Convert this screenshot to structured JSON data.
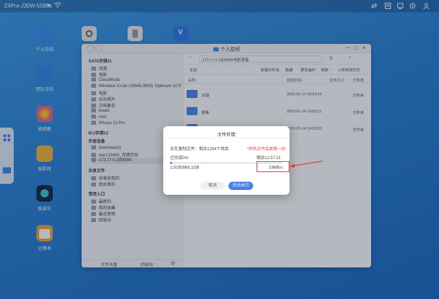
{
  "topbar": {
    "device_name": "Z4Pro-J30W-5588a",
    "caret": "▾"
  },
  "desktop": {
    "icons": [
      {
        "label": "个人空间",
        "color": "#3f8ef0"
      },
      {
        "label": "团队空间",
        "color": "#3a86e8"
      },
      {
        "label": "极相册",
        "color": "#f2a43a"
      },
      {
        "label": "极影视",
        "color": "#f4b63a"
      },
      {
        "label": "极音乐",
        "color": "#3ad0c8"
      },
      {
        "label": "记事本",
        "color": "#f7a23c"
      }
    ]
  },
  "window": {
    "title": "个人空间",
    "path": "172.17.0.2@8080/电影演唱",
    "toolbar": [
      "全选",
      "新建文件夹",
      "新建",
      "更多操作",
      "刷新",
      "上传电视文件"
    ],
    "columns": {
      "name": "名称",
      "modified": "修改时间",
      "size": "文件大小",
      "type": "文件类"
    },
    "files": [
      {
        "name": "动漫",
        "modified": "2023-01-14 19:54:15",
        "type": "文件夹"
      },
      {
        "name": "剧集",
        "modified": "2023-01-14 19:53:11",
        "type": "文件夹"
      },
      {
        "name": "",
        "modified": "2023-01-14 19:53:53",
        "type": "文件夹"
      }
    ],
    "sidebar": {
      "sections": [
        {
          "head": "SATA存储11",
          "items": [
            "动漫",
            "电影",
            "CloudMusic",
            "Windows X-Lite (19045.3930) 'Optimum 10 P",
            "电影",
            "乐乐照片",
            "文档备份",
            "books",
            "mov",
            "iPhone 13 Pro"
          ]
        },
        {
          "head": "M.2存储12",
          "items": []
        },
        {
          "head": "外部设备",
          "items": [
            "downloads3",
            "star123456_存储空间",
            "172.17.0.2@8080"
          ]
        },
        {
          "head": "共享文件",
          "items": [
            "共享给我的",
            "我共享的"
          ]
        },
        {
          "head": "常用入口",
          "items": [
            "最新的",
            "我的收藏",
            "最近使用",
            "回收站"
          ]
        }
      ],
      "footer_left": "文件去重",
      "footer_right": "回收站"
    }
  },
  "dialog": {
    "title": "文件处理",
    "copying_label": "正在复制文件：剩余1294个项目",
    "duplicate_notice": "*同名文件会复制一份",
    "completed_label": "已完成0%",
    "remaining_label": "剩余12:57:21",
    "size_progress": "1.5GB/868.1GB",
    "speed": "19MB/s",
    "progress_fraction": 0.002,
    "cancel_label": "取消",
    "background_label": "后台执行"
  },
  "colors": {
    "accent": "#4a7fe8",
    "highlight": "#e53b3b"
  }
}
